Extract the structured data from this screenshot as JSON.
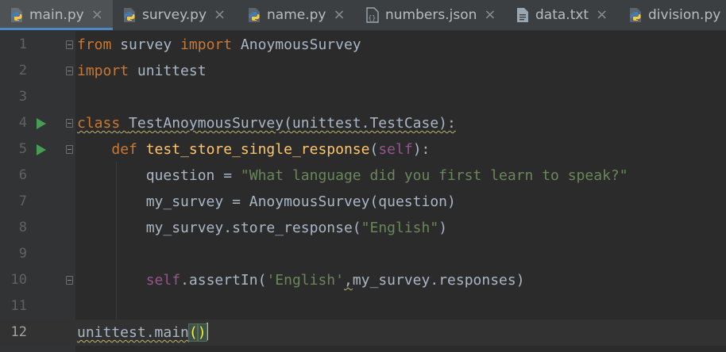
{
  "tabs": [
    {
      "label": "main.py",
      "icon": "python-file-icon",
      "active": true
    },
    {
      "label": "survey.py",
      "icon": "python-file-icon",
      "active": false
    },
    {
      "label": "name.py",
      "icon": "python-file-icon",
      "active": false
    },
    {
      "label": "numbers.json",
      "icon": "json-file-icon",
      "active": false
    },
    {
      "label": "data.txt",
      "icon": "text-file-icon",
      "active": false
    },
    {
      "label": "division.py",
      "icon": "python-file-icon",
      "active": false
    }
  ],
  "close_glyph": "×",
  "line_numbers": [
    "1",
    "2",
    "3",
    "4",
    "5",
    "6",
    "7",
    "8",
    "9",
    "10",
    "11",
    "12"
  ],
  "code": {
    "l1": {
      "t1": "from",
      "t2": " survey ",
      "t3": "import",
      "t4": " AnoymousSurvey"
    },
    "l2": {
      "t1": "import",
      "t2": " unittest"
    },
    "l4": {
      "t1": "class",
      "t2": " ",
      "t3": "TestAnoymousSurvey(unittest.TestCase):"
    },
    "l5": {
      "indent": "    ",
      "t1": "def",
      "t2": " ",
      "t3": "test_store_single_response",
      "t4": "(",
      "t5": "self",
      "t6": "):"
    },
    "l6": {
      "indent": "        ",
      "t1": "question = ",
      "t2": "\"What language did you first learn to speak?\""
    },
    "l7": {
      "indent": "        ",
      "t1": "my_survey = AnoymousSurvey(question)"
    },
    "l8": {
      "indent": "        ",
      "t1": "my_survey.store_response(",
      "t2": "\"English\"",
      "t3": ")"
    },
    "l10": {
      "indent": "        ",
      "t1": "self",
      "t2": ".assertIn(",
      "t3": "'English'",
      "t4": ",",
      "t5": "my_survey.responses)"
    },
    "l12": {
      "t1": "unittest.main",
      "t2": "(",
      "t3": ")"
    }
  },
  "colors": {
    "background": "#2b2b2b",
    "gutter": "#313335",
    "keyword": "#cc7832",
    "string": "#6a8759",
    "self": "#94558d",
    "function": "#ffc66d",
    "run_marker": "#499c54",
    "active_tab_underline": "#4a88c7"
  }
}
